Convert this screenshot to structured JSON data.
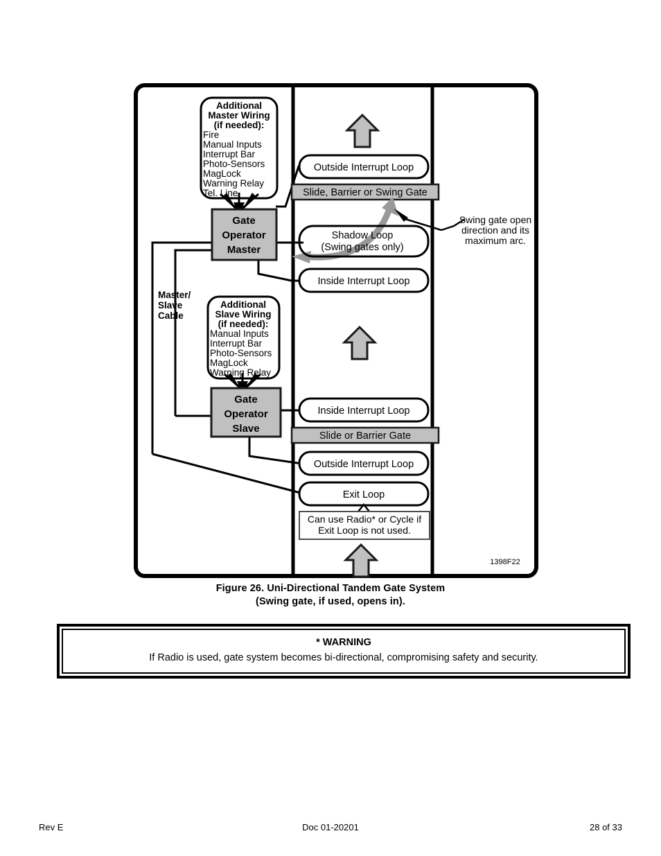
{
  "figure": {
    "drawing_id": "1398F22",
    "caption_line1": "Figure 26.  Uni-Directional Tandem Gate System",
    "caption_line2": "(Swing gate, if used, opens in).",
    "colors": {
      "operator_fill": "#c0c0c0",
      "gate_bar_fill": "#c0c0c0",
      "traffic_arrow_fill": "#c0c0c0",
      "swing_arc_arrow": "#999999",
      "outline": "#000000",
      "paper": "#ffffff"
    },
    "master_wiring_box": {
      "title_line1": "Additional",
      "title_line2": "Master Wiring",
      "title_line3": "(if needed):",
      "items": [
        "Fire",
        "Manual Inputs",
        "Interrupt  Bar",
        "Photo-Sensors",
        "MagLock",
        "Warning Relay",
        "Tel. Line"
      ]
    },
    "slave_wiring_box": {
      "title_line1": "Additional",
      "title_line2": "Slave Wiring",
      "title_line3": "(if needed):",
      "items": [
        "Manual Inputs",
        "Interrupt  Bar",
        "Photo-Sensors",
        "MagLock",
        "Warning Relay"
      ]
    },
    "operator_master": {
      "line1": "Gate",
      "line2": "Operator",
      "line3": "Master"
    },
    "operator_slave": {
      "line1": "Gate",
      "line2": "Operator",
      "line3": "Slave"
    },
    "cable_label": {
      "line1": "Master/",
      "line2": "Slave",
      "line3": "Cable"
    },
    "loops": {
      "master_outside": "Outside Interrupt  Loop",
      "master_shadow_line1": "Shadow Loop",
      "master_shadow_line2": "(Swing gates only)",
      "master_inside": "Inside Interrupt  Loop",
      "slave_inside": "Inside Interrupt  Loop",
      "slave_outside": "Outside Interrupt  Loop",
      "exit_loop": "Exit Loop"
    },
    "gate_bars": {
      "master": "Slide, Barrier or Swing Gate",
      "slave": "Slide or Barrier Gate"
    },
    "exit_note": {
      "line1": "Can use Radio* or Cycle if",
      "line2": "Exit Loop is not used."
    },
    "swing_annotation": {
      "line1": "Swing gate open",
      "line2": "direction and its",
      "line3": "maximum arc."
    }
  },
  "warning": {
    "title": "* WARNING",
    "text": "If Radio is used, gate system becomes bi-directional, compromising safety and security."
  },
  "footer": {
    "rev": "Rev E",
    "doc": "Doc 01-20201",
    "page": "28 of 33"
  }
}
